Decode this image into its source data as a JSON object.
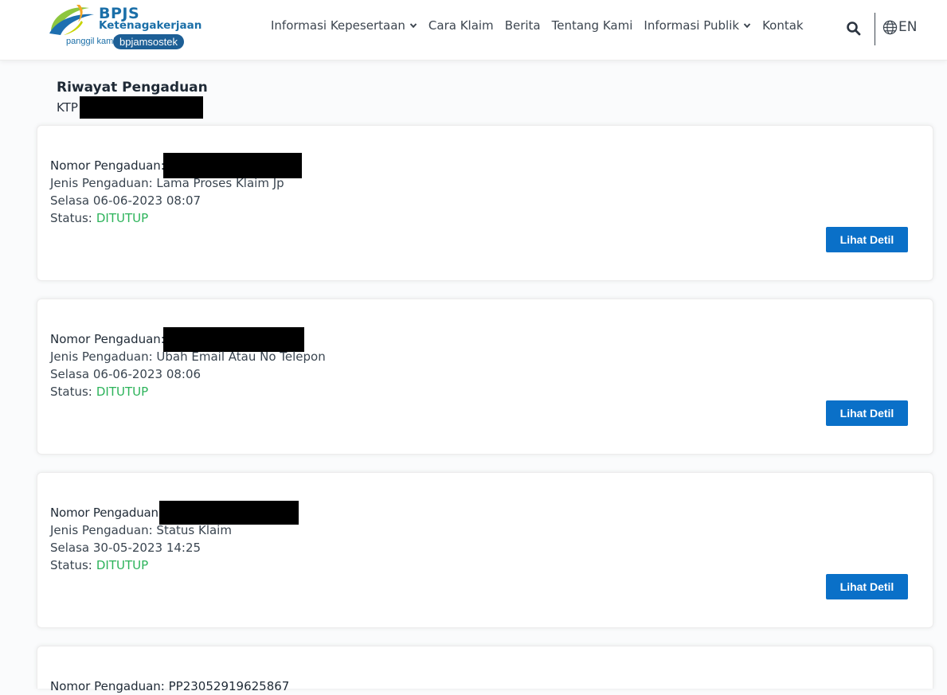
{
  "header": {
    "logo": {
      "title": "BPJS",
      "subtitle": "Ketenagakerjaan",
      "tagline": "panggil kami",
      "pill": "bpjamsostek"
    },
    "nav": [
      {
        "label": "Informasi Kepesertaan",
        "dropdown": true
      },
      {
        "label": "Cara Klaim",
        "dropdown": false
      },
      {
        "label": "Berita",
        "dropdown": false
      },
      {
        "label": "Tentang Kami",
        "dropdown": false
      },
      {
        "label": "Informasi Publik",
        "dropdown": true
      },
      {
        "label": "Kontak",
        "dropdown": false
      }
    ],
    "language": "EN"
  },
  "page": {
    "title": "Riwayat Pengaduan",
    "ktp_label": "KTP :"
  },
  "complaints": [
    {
      "number_label": "Nomor Pengaduan:",
      "type": "Jenis Pengaduan: Lama Proses Klaim Jp",
      "datetime": "Selasa 06-06-2023 08:07",
      "status_label": "Status:",
      "status_value": "DITUTUP",
      "button": "Lihat Detil"
    },
    {
      "number_label": "Nomor Pengaduan:",
      "type": "Jenis Pengaduan: Ubah Email Atau No Telepon",
      "datetime": "Selasa 06-06-2023 08:06",
      "status_label": "Status:",
      "status_value": "DITUTUP",
      "button": "Lihat Detil"
    },
    {
      "number_label": "Nomor Pengaduan:",
      "type": "Jenis Pengaduan: Status Klaim",
      "datetime": "Selasa 30-05-2023 14:25",
      "status_label": "Status:",
      "status_value": "DITUTUP",
      "button": "Lihat Detil"
    },
    {
      "number_label": "Nomor Pengaduan: PP23052919625867"
    }
  ],
  "colors": {
    "brand_blue": "#1b6fa8",
    "button_blue": "#0a70c8",
    "status_green": "#2cb35a"
  },
  "icons": [
    "logo-swoosh-icon",
    "chevron-down-icon",
    "search-icon",
    "globe-icon"
  ]
}
